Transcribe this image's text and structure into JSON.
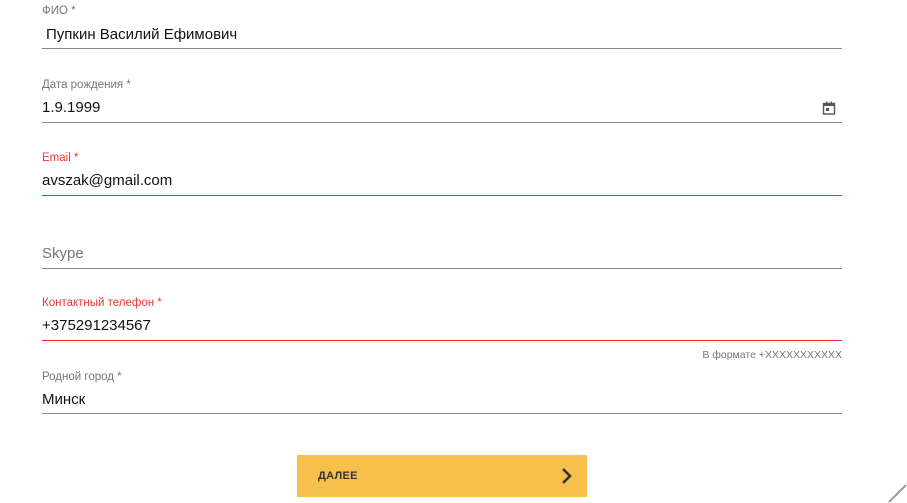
{
  "form": {
    "fio": {
      "label": "ФИО *",
      "value": "Пупкин Василий Ефимович"
    },
    "birthdate": {
      "label": "Дата рождения *",
      "value": "1.9.1999",
      "icon": "calendar-icon"
    },
    "email": {
      "label": "Email *",
      "value": "avszak@gmail.com",
      "state": "error"
    },
    "skype": {
      "placeholder": "Skype"
    },
    "phone": {
      "label": "Контактный телефон *",
      "value": "+375291234567",
      "hint": "В формате +XXXXXXXXXXX",
      "state": "error"
    },
    "city": {
      "label": "Родной город *",
      "value": "Минск"
    }
  },
  "next_button": {
    "label": "ДАЛЕЕ",
    "icon": "chevron-right-icon"
  },
  "colors": {
    "accent": "#f7c04a",
    "error": "#e53935",
    "label": "#777777",
    "text": "#111111"
  }
}
